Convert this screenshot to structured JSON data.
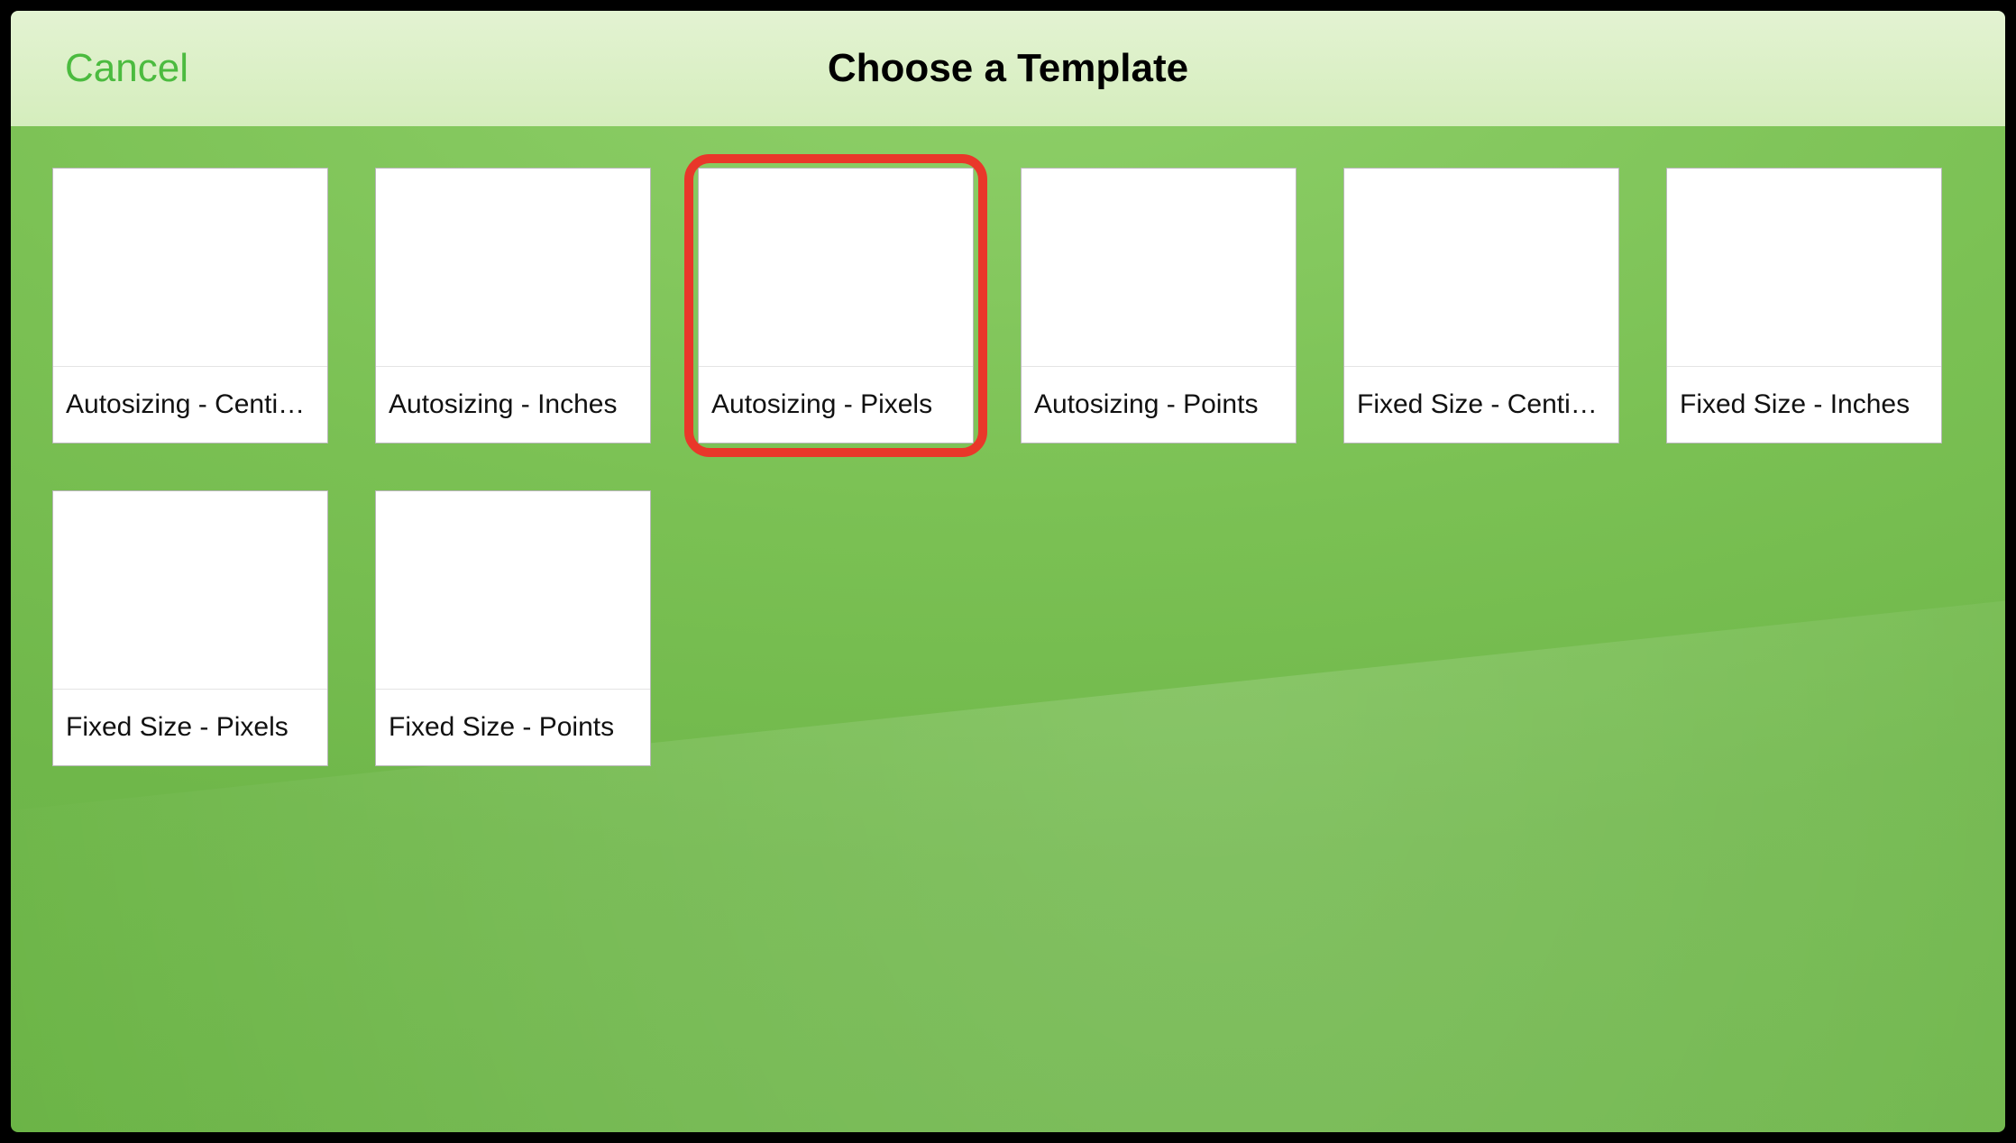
{
  "header": {
    "cancel_label": "Cancel",
    "title": "Choose a Template"
  },
  "templates": [
    {
      "label": "Autosizing - Centi…",
      "highlighted": false
    },
    {
      "label": "Autosizing - Inches",
      "highlighted": false
    },
    {
      "label": "Autosizing - Pixels",
      "highlighted": true
    },
    {
      "label": "Autosizing - Points",
      "highlighted": false
    },
    {
      "label": "Fixed Size - Centi…",
      "highlighted": false
    },
    {
      "label": "Fixed Size - Inches",
      "highlighted": false
    },
    {
      "label": "Fixed Size - Pixels",
      "highlighted": false
    },
    {
      "label": "Fixed Size - Points",
      "highlighted": false
    }
  ],
  "colors": {
    "accent_green": "#4bbb3f",
    "highlight_red": "#e9372a"
  }
}
